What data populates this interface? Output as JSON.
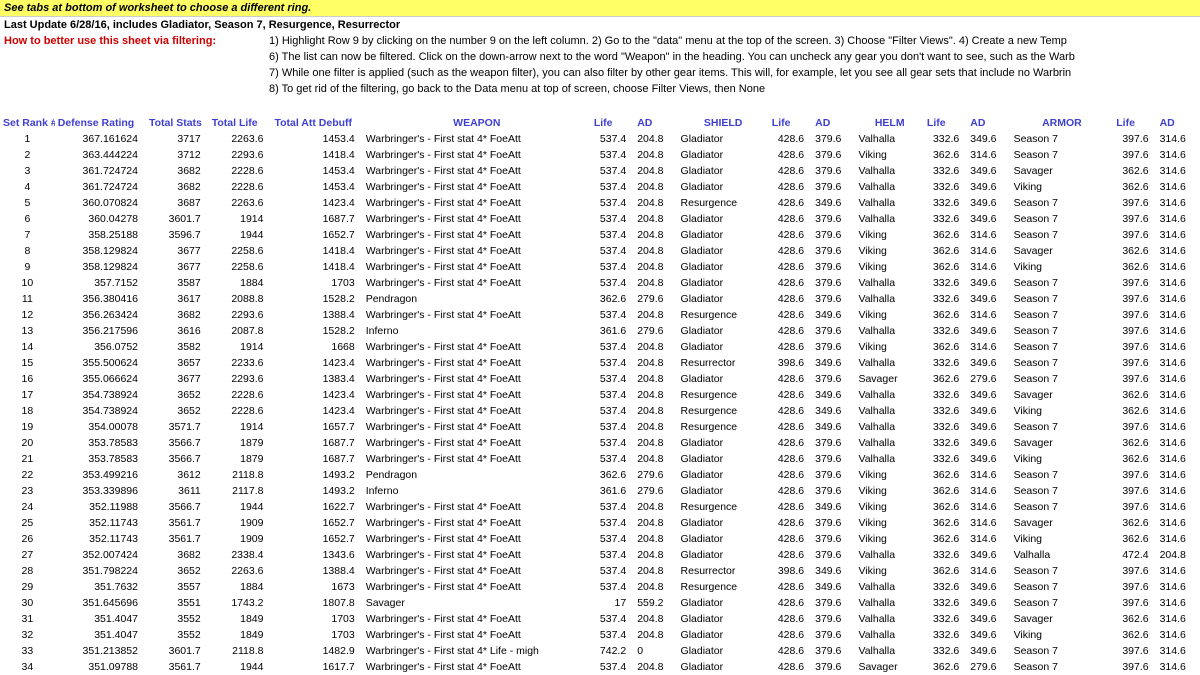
{
  "banner": "See tabs at bottom of worksheet to choose a different ring.",
  "update": "Last Update 6/28/16, includes Gladiator, Season 7, Resurgence, Resurrector",
  "filter_label": "How to better use this sheet via filtering:",
  "filter_lines": [
    "1) Highlight Row 9 by clicking on the number 9 on the left column. 2) Go to the \"data\" menu at the top of the screen. 3) Choose \"Filter Views\". 4) Create a new Temp",
    "6) The list can now be filtered. Click on the down-arrow next to the word \"Weapon\" in the heading. You can uncheck any gear you don't want to see, such as the Warb",
    "7) While one filter is applied (such as the weapon filter), you can also filter by other gear items. This will, for example, let you see all gear sets that include no Warbrin",
    "8) To get rid of the filtering, go back to the Data menu at top of screen, choose Filter Views, then None"
  ],
  "headers": {
    "rank": "Set Rank #",
    "def": "Defense Rating",
    "ts": "Total Stats",
    "tl": "Total Life",
    "tad": "Total Att Debuff",
    "weapon": "WEAPON",
    "life": "Life",
    "ad": "AD",
    "shield": "SHIELD",
    "helm": "HELM",
    "armor": "ARMOR"
  },
  "rows": [
    {
      "rank": "1",
      "def": "367.161624",
      "ts": "3717",
      "tl": "2263.6",
      "tad": "1453.4",
      "weapon": "Warbringer's - First stat 4* FoeAtt",
      "wl": "537.4",
      "wad": "204.8",
      "shield": "Gladiator",
      "sl": "428.6",
      "sad": "379.6",
      "helm": "Valhalla",
      "hl": "332.6",
      "had": "349.6",
      "armor": "Season 7",
      "al": "397.6",
      "aad": "314.6"
    },
    {
      "rank": "2",
      "def": "363.444224",
      "ts": "3712",
      "tl": "2293.6",
      "tad": "1418.4",
      "weapon": "Warbringer's - First stat 4* FoeAtt",
      "wl": "537.4",
      "wad": "204.8",
      "shield": "Gladiator",
      "sl": "428.6",
      "sad": "379.6",
      "helm": "Viking",
      "hl": "362.6",
      "had": "314.6",
      "armor": "Season 7",
      "al": "397.6",
      "aad": "314.6"
    },
    {
      "rank": "3",
      "def": "361.724724",
      "ts": "3682",
      "tl": "2228.6",
      "tad": "1453.4",
      "weapon": "Warbringer's - First stat 4* FoeAtt",
      "wl": "537.4",
      "wad": "204.8",
      "shield": "Gladiator",
      "sl": "428.6",
      "sad": "379.6",
      "helm": "Valhalla",
      "hl": "332.6",
      "had": "349.6",
      "armor": "Savager",
      "al": "362.6",
      "aad": "314.6"
    },
    {
      "rank": "4",
      "def": "361.724724",
      "ts": "3682",
      "tl": "2228.6",
      "tad": "1453.4",
      "weapon": "Warbringer's - First stat 4* FoeAtt",
      "wl": "537.4",
      "wad": "204.8",
      "shield": "Gladiator",
      "sl": "428.6",
      "sad": "379.6",
      "helm": "Valhalla",
      "hl": "332.6",
      "had": "349.6",
      "armor": "Viking",
      "al": "362.6",
      "aad": "314.6"
    },
    {
      "rank": "5",
      "def": "360.070824",
      "ts": "3687",
      "tl": "2263.6",
      "tad": "1423.4",
      "weapon": "Warbringer's - First stat 4* FoeAtt",
      "wl": "537.4",
      "wad": "204.8",
      "shield": "Resurgence",
      "sl": "428.6",
      "sad": "349.6",
      "helm": "Valhalla",
      "hl": "332.6",
      "had": "349.6",
      "armor": "Season 7",
      "al": "397.6",
      "aad": "314.6"
    },
    {
      "rank": "6",
      "def": "360.04278",
      "ts": "3601.7",
      "tl": "1914",
      "tad": "1687.7",
      "weapon": "Warbringer's - First stat 4* FoeAtt",
      "wl": "537.4",
      "wad": "204.8",
      "shield": "Gladiator",
      "sl": "428.6",
      "sad": "379.6",
      "helm": "Valhalla",
      "hl": "332.6",
      "had": "349.6",
      "armor": "Season 7",
      "al": "397.6",
      "aad": "314.6"
    },
    {
      "rank": "7",
      "def": "358.25188",
      "ts": "3596.7",
      "tl": "1944",
      "tad": "1652.7",
      "weapon": "Warbringer's - First stat 4* FoeAtt",
      "wl": "537.4",
      "wad": "204.8",
      "shield": "Gladiator",
      "sl": "428.6",
      "sad": "379.6",
      "helm": "Viking",
      "hl": "362.6",
      "had": "314.6",
      "armor": "Season 7",
      "al": "397.6",
      "aad": "314.6"
    },
    {
      "rank": "8",
      "def": "358.129824",
      "ts": "3677",
      "tl": "2258.6",
      "tad": "1418.4",
      "weapon": "Warbringer's - First stat 4* FoeAtt",
      "wl": "537.4",
      "wad": "204.8",
      "shield": "Gladiator",
      "sl": "428.6",
      "sad": "379.6",
      "helm": "Viking",
      "hl": "362.6",
      "had": "314.6",
      "armor": "Savager",
      "al": "362.6",
      "aad": "314.6"
    },
    {
      "rank": "9",
      "def": "358.129824",
      "ts": "3677",
      "tl": "2258.6",
      "tad": "1418.4",
      "weapon": "Warbringer's - First stat 4* FoeAtt",
      "wl": "537.4",
      "wad": "204.8",
      "shield": "Gladiator",
      "sl": "428.6",
      "sad": "379.6",
      "helm": "Viking",
      "hl": "362.6",
      "had": "314.6",
      "armor": "Viking",
      "al": "362.6",
      "aad": "314.6"
    },
    {
      "rank": "10",
      "def": "357.7152",
      "ts": "3587",
      "tl": "1884",
      "tad": "1703",
      "weapon": "Warbringer's - First stat 4* FoeAtt",
      "wl": "537.4",
      "wad": "204.8",
      "shield": "Gladiator",
      "sl": "428.6",
      "sad": "379.6",
      "helm": "Valhalla",
      "hl": "332.6",
      "had": "349.6",
      "armor": "Season 7",
      "al": "397.6",
      "aad": "314.6"
    },
    {
      "rank": "11",
      "def": "356.380416",
      "ts": "3617",
      "tl": "2088.8",
      "tad": "1528.2",
      "weapon": "Pendragon",
      "wl": "362.6",
      "wad": "279.6",
      "shield": "Gladiator",
      "sl": "428.6",
      "sad": "379.6",
      "helm": "Valhalla",
      "hl": "332.6",
      "had": "349.6",
      "armor": "Season 7",
      "al": "397.6",
      "aad": "314.6"
    },
    {
      "rank": "12",
      "def": "356.263424",
      "ts": "3682",
      "tl": "2293.6",
      "tad": "1388.4",
      "weapon": "Warbringer's - First stat 4* FoeAtt",
      "wl": "537.4",
      "wad": "204.8",
      "shield": "Resurgence",
      "sl": "428.6",
      "sad": "349.6",
      "helm": "Viking",
      "hl": "362.6",
      "had": "314.6",
      "armor": "Season 7",
      "al": "397.6",
      "aad": "314.6"
    },
    {
      "rank": "13",
      "def": "356.217596",
      "ts": "3616",
      "tl": "2087.8",
      "tad": "1528.2",
      "weapon": "Inferno",
      "wl": "361.6",
      "wad": "279.6",
      "shield": "Gladiator",
      "sl": "428.6",
      "sad": "379.6",
      "helm": "Valhalla",
      "hl": "332.6",
      "had": "349.6",
      "armor": "Season 7",
      "al": "397.6",
      "aad": "314.6"
    },
    {
      "rank": "14",
      "def": "356.0752",
      "ts": "3582",
      "tl": "1914",
      "tad": "1668",
      "weapon": "Warbringer's - First stat 4* FoeAtt",
      "wl": "537.4",
      "wad": "204.8",
      "shield": "Gladiator",
      "sl": "428.6",
      "sad": "379.6",
      "helm": "Viking",
      "hl": "362.6",
      "had": "314.6",
      "armor": "Season 7",
      "al": "397.6",
      "aad": "314.6"
    },
    {
      "rank": "15",
      "def": "355.500624",
      "ts": "3657",
      "tl": "2233.6",
      "tad": "1423.4",
      "weapon": "Warbringer's - First stat 4* FoeAtt",
      "wl": "537.4",
      "wad": "204.8",
      "shield": "Resurrector",
      "sl": "398.6",
      "sad": "349.6",
      "helm": "Valhalla",
      "hl": "332.6",
      "had": "349.6",
      "armor": "Season 7",
      "al": "397.6",
      "aad": "314.6"
    },
    {
      "rank": "16",
      "def": "355.066624",
      "ts": "3677",
      "tl": "2293.6",
      "tad": "1383.4",
      "weapon": "Warbringer's - First stat 4* FoeAtt",
      "wl": "537.4",
      "wad": "204.8",
      "shield": "Gladiator",
      "sl": "428.6",
      "sad": "379.6",
      "helm": "Savager",
      "hl": "362.6",
      "had": "279.6",
      "armor": "Season 7",
      "al": "397.6",
      "aad": "314.6"
    },
    {
      "rank": "17",
      "def": "354.738924",
      "ts": "3652",
      "tl": "2228.6",
      "tad": "1423.4",
      "weapon": "Warbringer's - First stat 4* FoeAtt",
      "wl": "537.4",
      "wad": "204.8",
      "shield": "Resurgence",
      "sl": "428.6",
      "sad": "349.6",
      "helm": "Valhalla",
      "hl": "332.6",
      "had": "349.6",
      "armor": "Savager",
      "al": "362.6",
      "aad": "314.6"
    },
    {
      "rank": "18",
      "def": "354.738924",
      "ts": "3652",
      "tl": "2228.6",
      "tad": "1423.4",
      "weapon": "Warbringer's - First stat 4* FoeAtt",
      "wl": "537.4",
      "wad": "204.8",
      "shield": "Resurgence",
      "sl": "428.6",
      "sad": "349.6",
      "helm": "Valhalla",
      "hl": "332.6",
      "had": "349.6",
      "armor": "Viking",
      "al": "362.6",
      "aad": "314.6"
    },
    {
      "rank": "19",
      "def": "354.00078",
      "ts": "3571.7",
      "tl": "1914",
      "tad": "1657.7",
      "weapon": "Warbringer's - First stat 4* FoeAtt",
      "wl": "537.4",
      "wad": "204.8",
      "shield": "Resurgence",
      "sl": "428.6",
      "sad": "349.6",
      "helm": "Valhalla",
      "hl": "332.6",
      "had": "349.6",
      "armor": "Season 7",
      "al": "397.6",
      "aad": "314.6"
    },
    {
      "rank": "20",
      "def": "353.78583",
      "ts": "3566.7",
      "tl": "1879",
      "tad": "1687.7",
      "weapon": "Warbringer's - First stat 4* FoeAtt",
      "wl": "537.4",
      "wad": "204.8",
      "shield": "Gladiator",
      "sl": "428.6",
      "sad": "379.6",
      "helm": "Valhalla",
      "hl": "332.6",
      "had": "349.6",
      "armor": "Savager",
      "al": "362.6",
      "aad": "314.6"
    },
    {
      "rank": "21",
      "def": "353.78583",
      "ts": "3566.7",
      "tl": "1879",
      "tad": "1687.7",
      "weapon": "Warbringer's - First stat 4* FoeAtt",
      "wl": "537.4",
      "wad": "204.8",
      "shield": "Gladiator",
      "sl": "428.6",
      "sad": "379.6",
      "helm": "Valhalla",
      "hl": "332.6",
      "had": "349.6",
      "armor": "Viking",
      "al": "362.6",
      "aad": "314.6"
    },
    {
      "rank": "22",
      "def": "353.499216",
      "ts": "3612",
      "tl": "2118.8",
      "tad": "1493.2",
      "weapon": "Pendragon",
      "wl": "362.6",
      "wad": "279.6",
      "shield": "Gladiator",
      "sl": "428.6",
      "sad": "379.6",
      "helm": "Viking",
      "hl": "362.6",
      "had": "314.6",
      "armor": "Season 7",
      "al": "397.6",
      "aad": "314.6"
    },
    {
      "rank": "23",
      "def": "353.339896",
      "ts": "3611",
      "tl": "2117.8",
      "tad": "1493.2",
      "weapon": "Inferno",
      "wl": "361.6",
      "wad": "279.6",
      "shield": "Gladiator",
      "sl": "428.6",
      "sad": "379.6",
      "helm": "Viking",
      "hl": "362.6",
      "had": "314.6",
      "armor": "Season 7",
      "al": "397.6",
      "aad": "314.6"
    },
    {
      "rank": "24",
      "def": "352.11988",
      "ts": "3566.7",
      "tl": "1944",
      "tad": "1622.7",
      "weapon": "Warbringer's - First stat 4* FoeAtt",
      "wl": "537.4",
      "wad": "204.8",
      "shield": "Resurgence",
      "sl": "428.6",
      "sad": "349.6",
      "helm": "Viking",
      "hl": "362.6",
      "had": "314.6",
      "armor": "Season 7",
      "al": "397.6",
      "aad": "314.6"
    },
    {
      "rank": "25",
      "def": "352.11743",
      "ts": "3561.7",
      "tl": "1909",
      "tad": "1652.7",
      "weapon": "Warbringer's - First stat 4* FoeAtt",
      "wl": "537.4",
      "wad": "204.8",
      "shield": "Gladiator",
      "sl": "428.6",
      "sad": "379.6",
      "helm": "Viking",
      "hl": "362.6",
      "had": "314.6",
      "armor": "Savager",
      "al": "362.6",
      "aad": "314.6"
    },
    {
      "rank": "26",
      "def": "352.11743",
      "ts": "3561.7",
      "tl": "1909",
      "tad": "1652.7",
      "weapon": "Warbringer's - First stat 4* FoeAtt",
      "wl": "537.4",
      "wad": "204.8",
      "shield": "Gladiator",
      "sl": "428.6",
      "sad": "379.6",
      "helm": "Viking",
      "hl": "362.6",
      "had": "314.6",
      "armor": "Viking",
      "al": "362.6",
      "aad": "314.6"
    },
    {
      "rank": "27",
      "def": "352.007424",
      "ts": "3682",
      "tl": "2338.4",
      "tad": "1343.6",
      "weapon": "Warbringer's - First stat 4* FoeAtt",
      "wl": "537.4",
      "wad": "204.8",
      "shield": "Gladiator",
      "sl": "428.6",
      "sad": "379.6",
      "helm": "Valhalla",
      "hl": "332.6",
      "had": "349.6",
      "armor": "Valhalla",
      "al": "472.4",
      "aad": "204.8"
    },
    {
      "rank": "28",
      "def": "351.798224",
      "ts": "3652",
      "tl": "2263.6",
      "tad": "1388.4",
      "weapon": "Warbringer's - First stat 4* FoeAtt",
      "wl": "537.4",
      "wad": "204.8",
      "shield": "Resurrector",
      "sl": "398.6",
      "sad": "349.6",
      "helm": "Viking",
      "hl": "362.6",
      "had": "314.6",
      "armor": "Season 7",
      "al": "397.6",
      "aad": "314.6"
    },
    {
      "rank": "29",
      "def": "351.7632",
      "ts": "3557",
      "tl": "1884",
      "tad": "1673",
      "weapon": "Warbringer's - First stat 4* FoeAtt",
      "wl": "537.4",
      "wad": "204.8",
      "shield": "Resurgence",
      "sl": "428.6",
      "sad": "349.6",
      "helm": "Valhalla",
      "hl": "332.6",
      "had": "349.6",
      "armor": "Season 7",
      "al": "397.6",
      "aad": "314.6"
    },
    {
      "rank": "30",
      "def": "351.645696",
      "ts": "3551",
      "tl": "1743.2",
      "tad": "1807.8",
      "weapon": "Savager",
      "wl": "17",
      "wad": "559.2",
      "shield": "Gladiator",
      "sl": "428.6",
      "sad": "379.6",
      "helm": "Valhalla",
      "hl": "332.6",
      "had": "349.6",
      "armor": "Season 7",
      "al": "397.6",
      "aad": "314.6"
    },
    {
      "rank": "31",
      "def": "351.4047",
      "ts": "3552",
      "tl": "1849",
      "tad": "1703",
      "weapon": "Warbringer's - First stat 4* FoeAtt",
      "wl": "537.4",
      "wad": "204.8",
      "shield": "Gladiator",
      "sl": "428.6",
      "sad": "379.6",
      "helm": "Valhalla",
      "hl": "332.6",
      "had": "349.6",
      "armor": "Savager",
      "al": "362.6",
      "aad": "314.6"
    },
    {
      "rank": "32",
      "def": "351.4047",
      "ts": "3552",
      "tl": "1849",
      "tad": "1703",
      "weapon": "Warbringer's - First stat 4* FoeAtt",
      "wl": "537.4",
      "wad": "204.8",
      "shield": "Gladiator",
      "sl": "428.6",
      "sad": "379.6",
      "helm": "Valhalla",
      "hl": "332.6",
      "had": "349.6",
      "armor": "Viking",
      "al": "362.6",
      "aad": "314.6"
    },
    {
      "rank": "33",
      "def": "351.213852",
      "ts": "3601.7",
      "tl": "2118.8",
      "tad": "1482.9",
      "weapon": "Warbringer's - First stat 4* Life - migh",
      "wl": "742.2",
      "wad": "0",
      "shield": "Gladiator",
      "sl": "428.6",
      "sad": "379.6",
      "helm": "Valhalla",
      "hl": "332.6",
      "had": "349.6",
      "armor": "Season 7",
      "al": "397.6",
      "aad": "314.6"
    },
    {
      "rank": "34",
      "def": "351.09788",
      "ts": "3561.7",
      "tl": "1944",
      "tad": "1617.7",
      "weapon": "Warbringer's - First stat 4* FoeAtt",
      "wl": "537.4",
      "wad": "204.8",
      "shield": "Gladiator",
      "sl": "428.6",
      "sad": "379.6",
      "helm": "Savager",
      "hl": "362.6",
      "had": "279.6",
      "armor": "Season 7",
      "al": "397.6",
      "aad": "314.6"
    }
  ]
}
